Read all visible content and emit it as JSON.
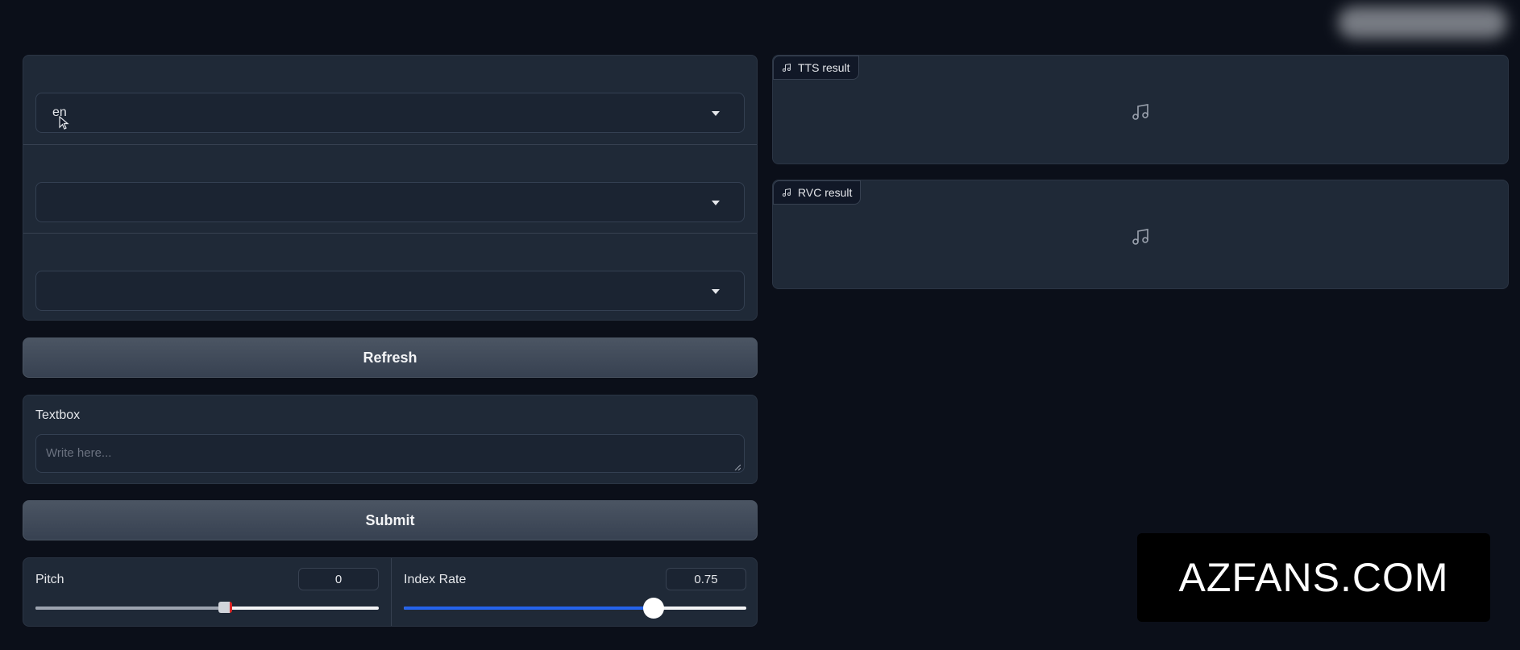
{
  "dropdowns": [
    {
      "value": "en"
    },
    {
      "value": ""
    },
    {
      "value": ""
    }
  ],
  "buttons": {
    "refresh_label": "Refresh",
    "submit_label": "Submit"
  },
  "textbox": {
    "label": "Textbox",
    "placeholder": "Write here..."
  },
  "sliders": {
    "pitch": {
      "label": "Pitch",
      "value": "0",
      "fraction": 0.55
    },
    "index_rate": {
      "label": "Index Rate",
      "value": "0.75",
      "fraction": 0.73
    }
  },
  "audio": {
    "tts_label": "TTS result",
    "rvc_label": "RVC result"
  },
  "watermark": {
    "text": "AZFANS.COM"
  },
  "colors": {
    "background": "#0b0f19",
    "panel": "#1f2937",
    "slider_accent": "#2563eb",
    "pitch_thumb_accent": "#dc2626"
  }
}
